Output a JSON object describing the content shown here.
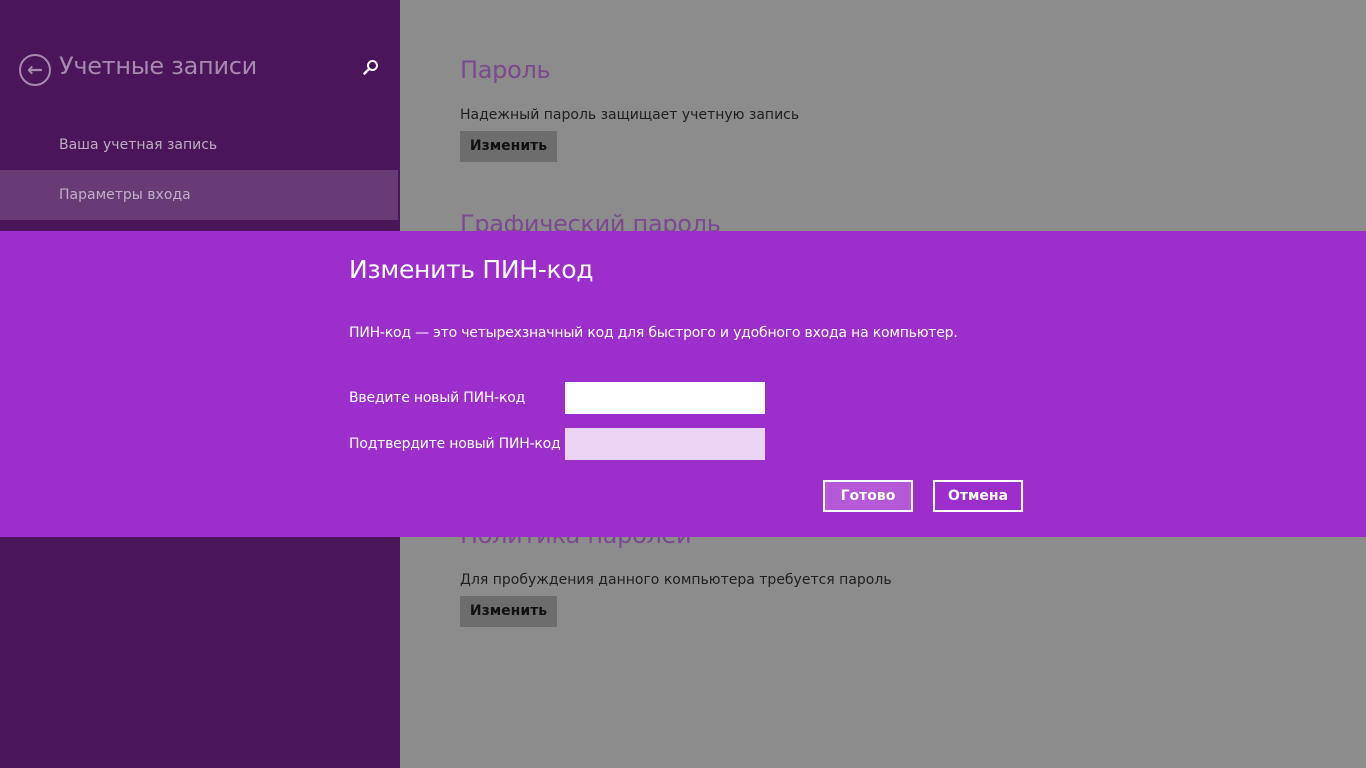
{
  "sidebar": {
    "title": "Учетные записи",
    "back_icon": "back-arrow-icon",
    "search_icon": "search-icon",
    "items": [
      {
        "label": "Ваша учетная запись",
        "selected": false
      },
      {
        "label": "Параметры входа",
        "selected": true
      }
    ]
  },
  "main": {
    "sections": [
      {
        "title": "Пароль",
        "description": "Надежный пароль защищает учетную запись",
        "button_label": "Изменить"
      },
      {
        "title": "Графический пароль"
      },
      {
        "title": "Политика паролей",
        "description": "Для пробуждения данного компьютера требуется пароль",
        "button_label": "Изменить"
      }
    ]
  },
  "dialog": {
    "title": "Изменить ПИН-код",
    "description": "ПИН-код — это четырехзначный код для быстрого и удобного входа на компьютер.",
    "new_pin_label": "Введите новый ПИН-код",
    "new_pin_value": "",
    "confirm_pin_label": "Подтвердите новый ПИН-код",
    "confirm_pin_value": "",
    "ok_label": "Готово",
    "cancel_label": "Отмена"
  },
  "colors": {
    "sidebar_bg": "#4a155a",
    "sidebar_selected_bg": "#683b77",
    "dimmed_bg": "#8c8c8c",
    "dialog_bg": "#9c2fcc",
    "accent_text": "#7c488f"
  }
}
